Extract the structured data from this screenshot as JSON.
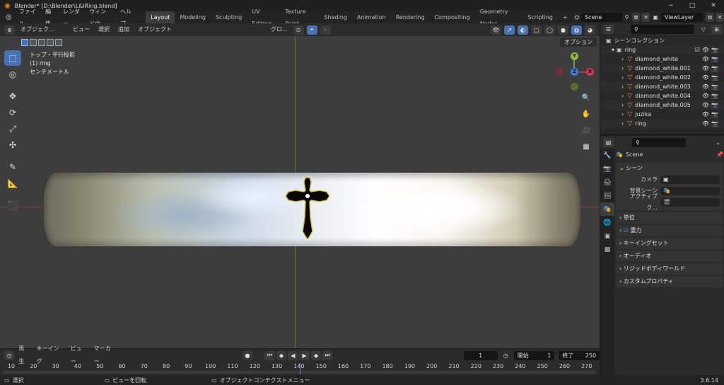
{
  "titlebar": {
    "title": "Blender* [D:\\Blender\\L&lRing.blend]",
    "minimize": "−",
    "maximize": "□",
    "close": "✕"
  },
  "menu": [
    "ファイル",
    "編集",
    "レンダー",
    "ウィンドウ",
    "ヘルプ"
  ],
  "workspaces": [
    "Layout",
    "Modeling",
    "Sculpting",
    "UV Editing",
    "Texture Paint",
    "Shading",
    "Animation",
    "Rendering",
    "Compositing",
    "Geometry Nodes",
    "Scripting"
  ],
  "active_workspace": "Layout",
  "add_workspace": "+",
  "scene_name": "Scene",
  "view_layer": "ViewLayer",
  "viewport_header": {
    "mode": "オブジェク...",
    "view": "ビュー",
    "select": "選択",
    "add": "追加",
    "object": "オブジェクト",
    "transform": "グロ...",
    "options": "オプション"
  },
  "viewport_info": {
    "line1": "トップ・平行投影",
    "line2": "(1) ring",
    "line3": "センチメートル"
  },
  "gizmo": {
    "x": "X",
    "y": "Y",
    "z": "Z"
  },
  "timeline": {
    "playback": "再生",
    "keying": "キーイング",
    "view": "ビュー",
    "marker": "マーカー",
    "current_frame": "1",
    "start_label": "開始",
    "start": "1",
    "end_label": "終了",
    "end": "250",
    "ticks": [
      "10",
      "20",
      "30",
      "40",
      "50",
      "60",
      "70",
      "80",
      "90",
      "100",
      "110",
      "120",
      "130",
      "140",
      "150",
      "160",
      "170",
      "180",
      "190",
      "200",
      "210",
      "220",
      "230",
      "240",
      "250",
      "260",
      "270"
    ]
  },
  "status": {
    "select": "選択",
    "rotate": "ビューを回転",
    "context": "オブジェクトコンテクストメニュー",
    "version": "3.6.14"
  },
  "outliner": {
    "root": "シーンコレクション",
    "collection": "ring",
    "items": [
      "diamond_white",
      "diamond_white.001",
      "diamond_white.002",
      "diamond_white.003",
      "diamond_white.004",
      "diamond_white.005",
      "juzika",
      "ring"
    ]
  },
  "properties": {
    "scene_name": "Scene",
    "scene_section": "シーン",
    "camera_label": "カメラ",
    "bg_scene_label": "背景シーン",
    "active_clip_label": "アクティブク...",
    "sections": [
      "単位",
      "重力",
      "キーイングセット",
      "オーディオ",
      "リジッドボディワールド",
      "カスタムプロパティ"
    ]
  }
}
